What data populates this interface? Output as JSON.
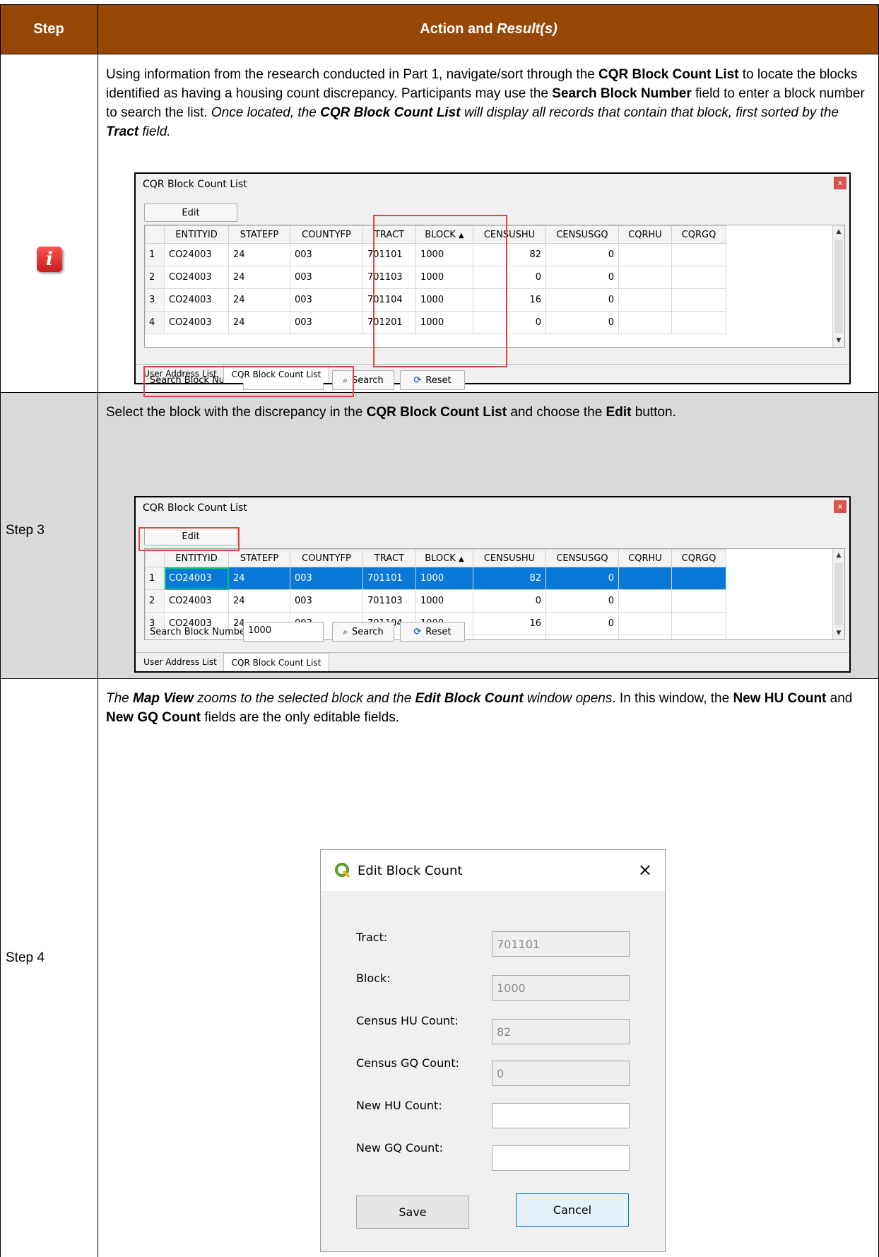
{
  "header": {
    "step": "Step",
    "action": "Action and",
    "result": "Result(s)"
  },
  "row1": {
    "para": {
      "t1": "Using information from the research conducted in Part 1, navigate/sort through the ",
      "b1": "CQR Block Count List",
      "t2": " to locate the blocks identified as having a housing count discrepancy. Participants may use the ",
      "b2": "Search Block Number",
      "t3": " field to enter a block number to search the list. ",
      "i1": "Once located, the ",
      "bi1": "CQR Block Count List",
      "i2": " will display all records that contain that block, first sorted by the ",
      "bi2": "Tract",
      "i3": " field."
    }
  },
  "panel": {
    "title": "CQR Block Count List",
    "close": "x",
    "edit_label": "Edit",
    "columns": [
      "",
      "ENTITYID",
      "STATEFP",
      "COUNTYFP",
      "TRACT",
      "BLOCK",
      "CENSUSHU",
      "CENSUSGQ",
      "CQRHU",
      "CQRGQ"
    ],
    "sort_indicator": "▲",
    "rows": [
      [
        "1",
        "CO24003",
        "24",
        "003",
        "701101",
        "1000",
        "82",
        "0",
        "",
        ""
      ],
      [
        "2",
        "CO24003",
        "24",
        "003",
        "701103",
        "1000",
        "0",
        "0",
        "",
        ""
      ],
      [
        "3",
        "CO24003",
        "24",
        "003",
        "701104",
        "1000",
        "16",
        "0",
        "",
        ""
      ],
      [
        "4",
        "CO24003",
        "24",
        "003",
        "701201",
        "1000",
        "0",
        "0",
        "",
        ""
      ]
    ],
    "search_label": "Search Block Number:",
    "search_value": "1000",
    "search_btn": "Search",
    "reset_btn": "Reset",
    "tab_user": "User Address List",
    "tab_cqr": "CQR Block Count List"
  },
  "row2": {
    "step": "Step 3",
    "t1": "Select the block with the discrepancy in the ",
    "b1": "CQR Block Count List",
    "t2": " and choose the ",
    "b2": "Edit",
    "t3": " button."
  },
  "row3": {
    "step": "Step 4",
    "t1": "The ",
    "b1": "Map View",
    "t2": " zooms to the selected block and the ",
    "b2": "Edit Block Count",
    "t3": " window opens",
    "t4": ". In this window, the ",
    "b3": "New HU Count",
    "t5": " and ",
    "b4": "New GQ Count",
    "t6": " fields are the only editable fields."
  },
  "dialog": {
    "title": "Edit Block Count",
    "close": "×",
    "fields": [
      {
        "label": "Tract:",
        "value": "701101"
      },
      {
        "label": "Block:",
        "value": "1000"
      },
      {
        "label": "Census HU Count:",
        "value": "82"
      },
      {
        "label": "Census GQ Count:",
        "value": "0"
      },
      {
        "label": "New HU Count:",
        "value": ""
      },
      {
        "label": "New GQ Count:",
        "value": ""
      }
    ],
    "save": "Save",
    "cancel": "Cancel"
  },
  "colors": {
    "header_bg": "#974806",
    "selection": "#0a78d7",
    "highlight": "#e04848",
    "row_gray": "#d9d9d9"
  }
}
